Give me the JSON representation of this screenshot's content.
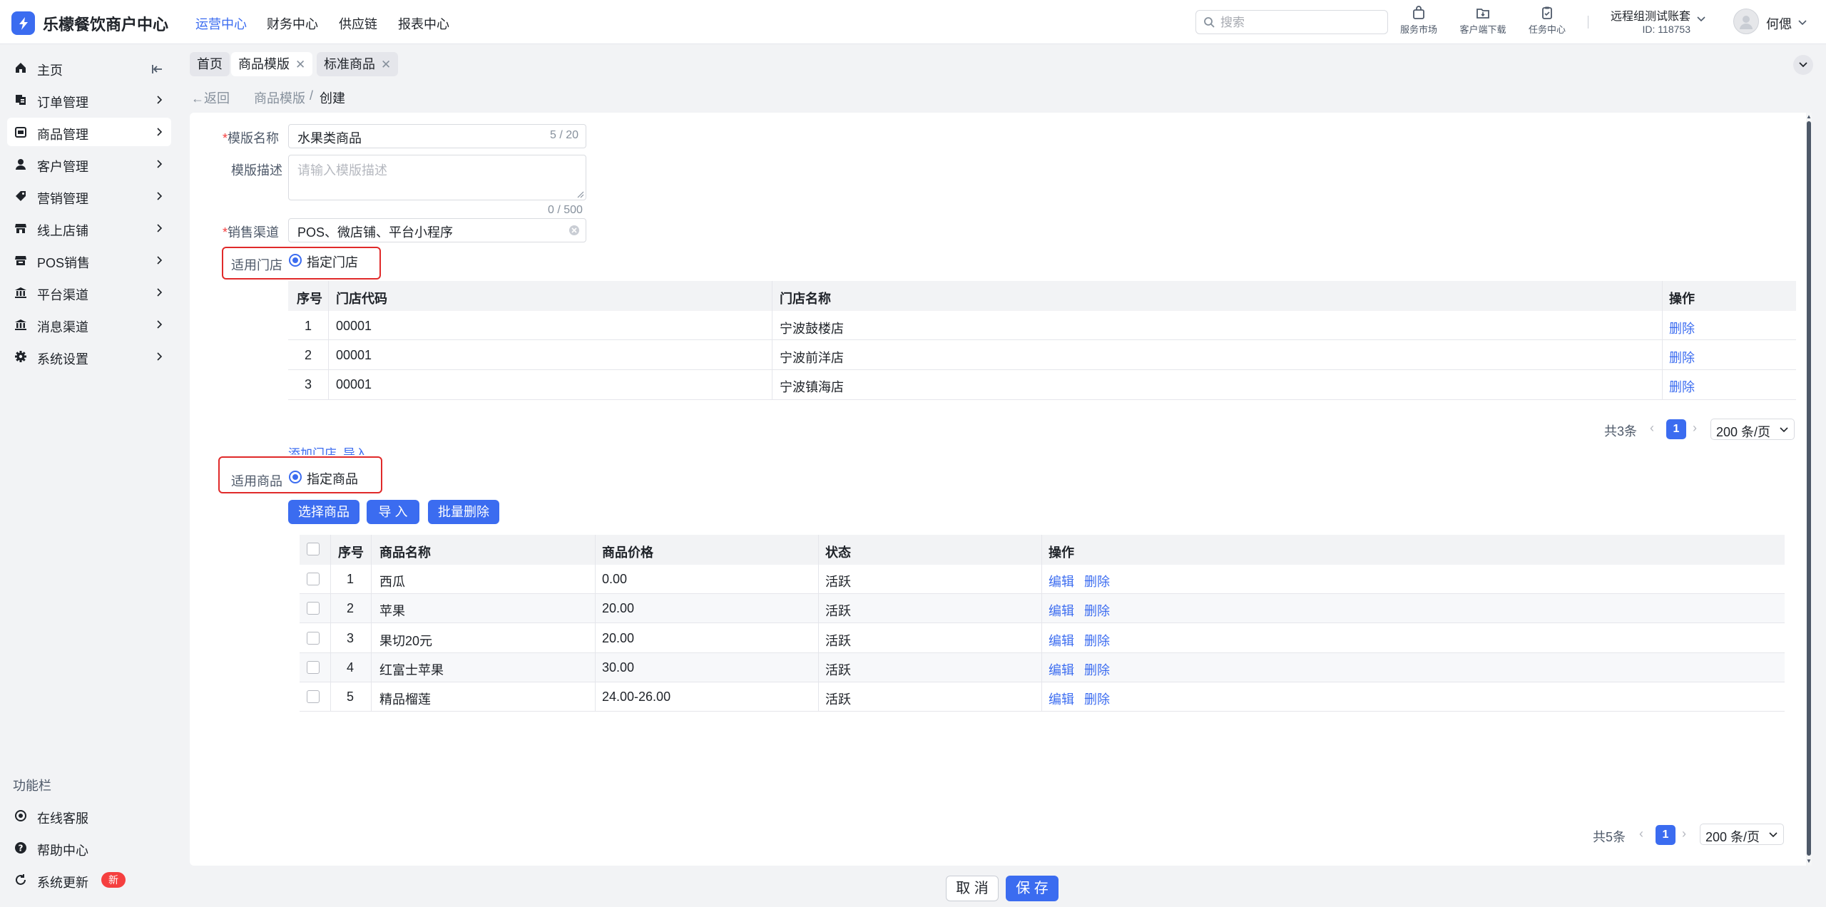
{
  "app": {
    "title": "乐檬餐饮商户中心"
  },
  "top_nav": [
    {
      "label": "运营中心"
    },
    {
      "label": "财务中心"
    },
    {
      "label": "供应链"
    },
    {
      "label": "报表中心"
    }
  ],
  "search": {
    "placeholder": "搜索",
    "value": ""
  },
  "toolbar": [
    {
      "label": "服务市场",
      "icon": "shop-bag-icon"
    },
    {
      "label": "客户端下载",
      "icon": "folder-download-icon"
    },
    {
      "label": "任务中心",
      "icon": "clipboard-icon"
    }
  ],
  "account": {
    "name": "远程组测试账套",
    "id": "ID: 118753"
  },
  "user": {
    "name": "何偲"
  },
  "sidebar": {
    "items": [
      {
        "label": "主页",
        "icon": "home-icon"
      },
      {
        "label": "订单管理",
        "icon": "order-icon"
      },
      {
        "label": "商品管理",
        "icon": "product-icon"
      },
      {
        "label": "客户管理",
        "icon": "user-icon"
      },
      {
        "label": "营销管理",
        "icon": "tag-icon"
      },
      {
        "label": "线上店铺",
        "icon": "store-icon"
      },
      {
        "label": "POS销售",
        "icon": "pos-store-icon"
      },
      {
        "label": "平台渠道",
        "icon": "bank-icon"
      },
      {
        "label": "消息渠道",
        "icon": "message-bank-icon"
      },
      {
        "label": "系统设置",
        "icon": "gear-icon"
      }
    ],
    "func_title": "功能栏",
    "func_items": [
      {
        "label": "在线客服",
        "icon": "support-icon"
      },
      {
        "label": "帮助中心",
        "icon": "help-icon"
      },
      {
        "label": "系统更新",
        "icon": "refresh-icon",
        "badge": "新"
      }
    ]
  },
  "tabs": [
    {
      "label": "首页"
    },
    {
      "label": "商品模版"
    },
    {
      "label": "标准商品"
    }
  ],
  "breadcrumb": {
    "back": "返回",
    "parent": "商品模版",
    "sep": "/",
    "current": "创建"
  },
  "form": {
    "name_label": "模版名称",
    "name_value": "水果类商品",
    "name_count": "5 / 20",
    "desc_label": "模版描述",
    "desc_placeholder": "请输入模版描述",
    "desc_count": "0 / 500",
    "channel_label": "销售渠道",
    "channel_value": "POS、微店铺、平台小程序",
    "store_label": "适用门店",
    "store_option": "指定门店",
    "goods_label": "适用商品",
    "goods_option": "指定商品"
  },
  "store_table": {
    "headers": [
      "序号",
      "门店代码",
      "门店名称",
      "操作"
    ],
    "rows": [
      {
        "no": "1",
        "code": "00001",
        "name": "宁波鼓楼店",
        "action": "删除"
      },
      {
        "no": "2",
        "code": "00001",
        "name": "宁波前洋店",
        "action": "删除"
      },
      {
        "no": "3",
        "code": "00001",
        "name": "宁波镇海店",
        "action": "删除"
      }
    ],
    "total": "共3条",
    "page": "1",
    "page_size": "200 条/页",
    "add_link": "添加门店",
    "import_link": "导入"
  },
  "goods_actions": {
    "select": "选择商品",
    "import": "导 入",
    "batch_delete": "批量删除"
  },
  "goods_table": {
    "headers": [
      "序号",
      "商品名称",
      "商品价格",
      "状态",
      "操作"
    ],
    "rows": [
      {
        "no": "1",
        "name": "西瓜",
        "price": "0.00",
        "status": "活跃",
        "edit": "编辑",
        "delete": "删除"
      },
      {
        "no": "2",
        "name": "苹果",
        "price": "20.00",
        "status": "活跃",
        "edit": "编辑",
        "delete": "删除"
      },
      {
        "no": "3",
        "name": "果切20元",
        "price": "20.00",
        "status": "活跃",
        "edit": "编辑",
        "delete": "删除"
      },
      {
        "no": "4",
        "name": "红富士苹果",
        "price": "30.00",
        "status": "活跃",
        "edit": "编辑",
        "delete": "删除"
      },
      {
        "no": "5",
        "name": "精品榴莲",
        "price": "24.00-26.00",
        "status": "活跃",
        "edit": "编辑",
        "delete": "删除"
      }
    ],
    "total": "共5条",
    "page": "1",
    "page_size": "200 条/页"
  },
  "footer": {
    "cancel": "取 消",
    "save": "保 存"
  },
  "colors": {
    "accent": "#3b6cf0",
    "danger": "#f53f3f",
    "highlight_box": "#e02a2a"
  }
}
